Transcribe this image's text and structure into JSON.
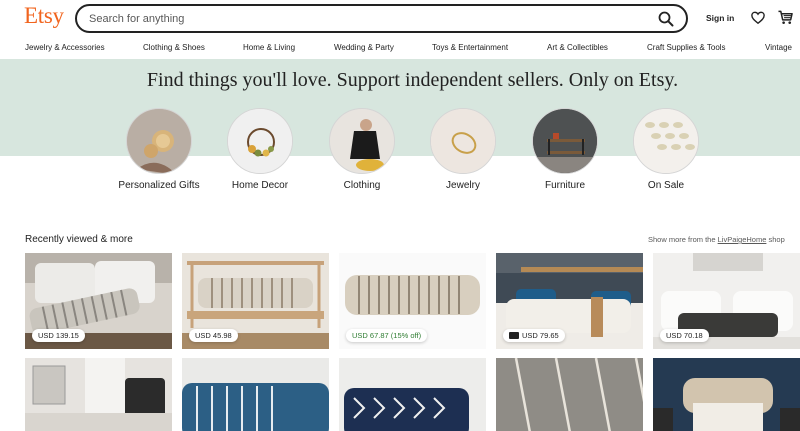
{
  "header": {
    "logo": "Etsy",
    "search_placeholder": "Search for anything",
    "signin": "Sign in"
  },
  "categories": [
    "Jewelry & Accessories",
    "Clothing & Shoes",
    "Home & Living",
    "Wedding & Party",
    "Toys & Entertainment",
    "Art & Collectibles",
    "Craft Supplies & Tools",
    "Vintage"
  ],
  "hero": {
    "title": "Find things you'll love. Support independent sellers. Only on Etsy.",
    "circles": [
      {
        "label": "Personalized Gifts"
      },
      {
        "label": "Home Decor"
      },
      {
        "label": "Clothing"
      },
      {
        "label": "Jewelry"
      },
      {
        "label": "Furniture"
      },
      {
        "label": "On Sale"
      }
    ]
  },
  "recent": {
    "title": "Recently viewed & more",
    "show_more_prefix": "Show more from the",
    "shop_name": "LivPaigeHome",
    "show_more_suffix": "shop",
    "items": [
      {
        "price": "USD 139.15"
      },
      {
        "price": "USD 45.98"
      },
      {
        "price": "USD 67.87 (15% off)"
      },
      {
        "price": "USD 79.65"
      },
      {
        "price": "USD 70.18"
      }
    ]
  },
  "colors": {
    "brand": "#f1641e",
    "hero_band": "#d7e6de",
    "sale_green": "#2f7d32"
  }
}
